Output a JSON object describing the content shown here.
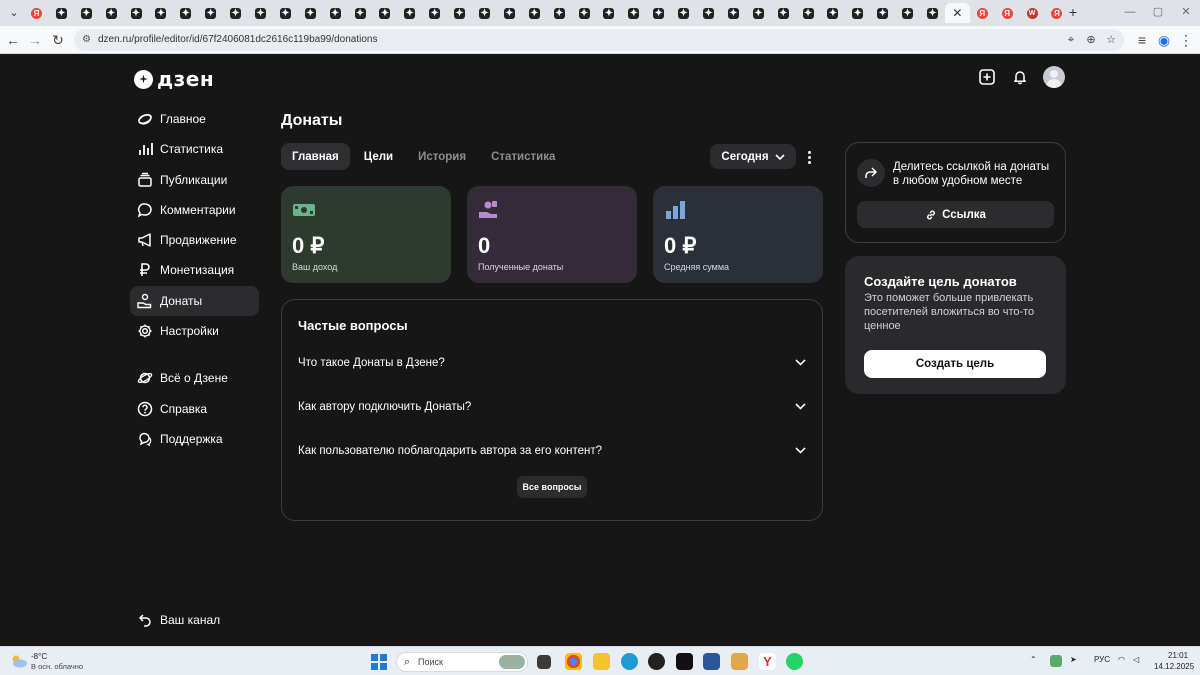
{
  "browser": {
    "active_url": "dzen.ru/profile/editor/id/67f2406081dc2616c119ba99/donations",
    "tabs_before_active": [
      "yandex",
      "dzen",
      "dzen",
      "dzen",
      "dzen",
      "dzen",
      "dzen",
      "dzen",
      "dzen",
      "dzen",
      "dzen",
      "dzen",
      "dzen",
      "dzen",
      "dzen",
      "dzen",
      "dzen",
      "dzen",
      "dzen",
      "dzen",
      "dzen",
      "dzen",
      "dzen",
      "dzen",
      "dzen",
      "dzen",
      "dzen",
      "dzen",
      "dzen",
      "dzen",
      "dzen",
      "dzen",
      "dzen",
      "dzen",
      "dzen",
      "dzen",
      "dzen"
    ],
    "tabs_after_active": [
      "yandex",
      "yandex",
      "wildberries",
      "yandex"
    ]
  },
  "header": {
    "logo_text": "дзен"
  },
  "sidebar": {
    "items": [
      {
        "label": "Главное",
        "icon": "home-icon"
      },
      {
        "label": "Статистика",
        "icon": "stats-icon"
      },
      {
        "label": "Публикации",
        "icon": "publications-icon"
      },
      {
        "label": "Комментарии",
        "icon": "comments-icon"
      },
      {
        "label": "Продвижение",
        "icon": "megaphone-icon"
      },
      {
        "label": "Монетизация",
        "icon": "ruble-icon"
      },
      {
        "label": "Донаты",
        "icon": "donations-icon"
      },
      {
        "label": "Настройки",
        "icon": "gear-icon"
      }
    ],
    "secondary": [
      {
        "label": "Всё о Дзене",
        "icon": "planet-icon"
      },
      {
        "label": "Справка",
        "icon": "help-icon"
      },
      {
        "label": "Поддержка",
        "icon": "chat-icon"
      }
    ],
    "channel_link": "Ваш канал",
    "active_item": "Донаты"
  },
  "main": {
    "title": "Донаты",
    "tabs": [
      {
        "label": "Главная"
      },
      {
        "label": "Цели"
      },
      {
        "label": "История"
      },
      {
        "label": "Статистика"
      }
    ],
    "period": "Сегодня",
    "stats": [
      {
        "value": "0 ₽",
        "label": "Ваш доход",
        "bg": "#2c3a2f"
      },
      {
        "value": "0",
        "label": "Полученные донаты",
        "bg": "#352b38"
      },
      {
        "value": "0 ₽",
        "label": "Средняя сумма",
        "bg": "#2b3038"
      }
    ],
    "faq": {
      "title": "Частые вопросы",
      "items": [
        {
          "question": "Что такое Донаты в Дзене?"
        },
        {
          "question": "Как автору подключить Донаты?"
        },
        {
          "question": "Как пользователю поблагодарить автора за его контент?"
        }
      ],
      "all_button": "Все вопросы"
    }
  },
  "share": {
    "text": "Делитесь ссылкой на донаты в любом удобном месте",
    "button": "Ссылка"
  },
  "goal": {
    "title": "Создайте цель донатов",
    "text": "Это поможет больше привлекать посетителей вложиться во что-то ценное",
    "button": "Создать цель"
  },
  "taskbar": {
    "weather_temp": "-8°C",
    "weather_desc": "В осн. облачно",
    "search_placeholder": "Поиск",
    "language": "РУС",
    "time": "21:01",
    "date": "14.12.2025"
  },
  "colors": {
    "background": "#161617",
    "card_income": "#2c3a2f",
    "card_donations": "#352b38",
    "card_average": "#2b3038",
    "icon_green": "#6bb38a",
    "icon_purple": "#b88ad6",
    "icon_blue": "#7aa6d9"
  }
}
